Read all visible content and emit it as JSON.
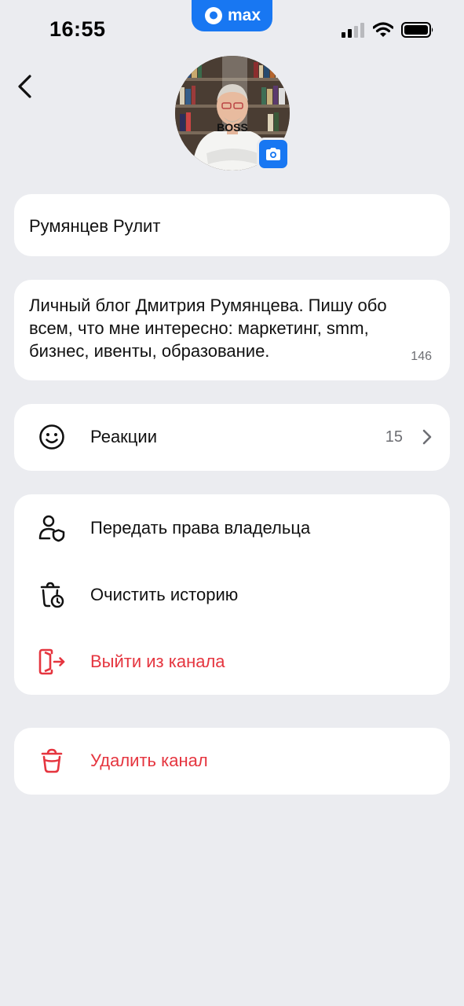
{
  "status_bar": {
    "time": "16:55",
    "island_label": "max"
  },
  "profile": {
    "avatar_shirt_text": "BOSS",
    "name": "Румянцев Рулит",
    "description": "Личный блог Дмитрия Румянцева. Пишу обо всем, что мне интересно: маркетинг, smm, бизнес, ивенты, образование.",
    "description_counter": "146"
  },
  "reactions": {
    "label": "Реакции",
    "count": "15",
    "icon": "smiley-icon"
  },
  "actions": [
    {
      "label": "Передать права владельца",
      "icon": "user-shield-icon"
    },
    {
      "label": "Очистить историю",
      "icon": "trash-clock-icon"
    },
    {
      "label": "Выйти из канала",
      "icon": "exit-icon"
    }
  ],
  "delete": {
    "label": "Удалить канал",
    "icon": "trash-icon"
  },
  "colors": {
    "background": "#ebecf0",
    "accent": "#1877f2",
    "danger": "#e5353f",
    "card": "#ffffff",
    "muted": "#6d6e73"
  }
}
